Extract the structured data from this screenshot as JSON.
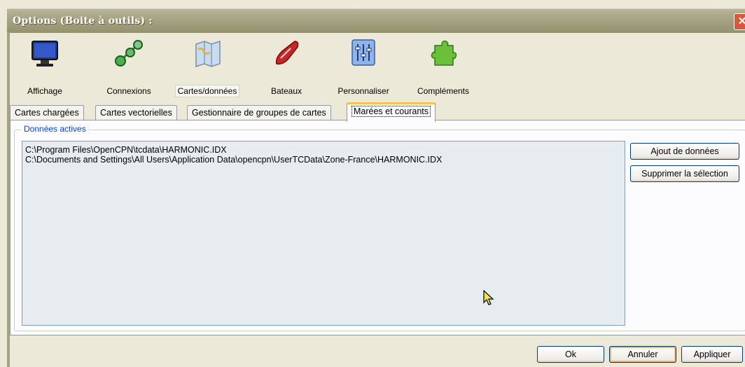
{
  "window": {
    "title": "Options (Boite à outils) :",
    "close_glyph": "✕"
  },
  "toolbar": {
    "items": [
      {
        "label": "Affichage",
        "icon": "monitor-icon"
      },
      {
        "label": "Connexions",
        "icon": "connections-icon"
      },
      {
        "label": "Cartes/données",
        "icon": "charts-icon",
        "selected": true
      },
      {
        "label": "Bateaux",
        "icon": "boat-icon"
      },
      {
        "label": "Personnaliser",
        "icon": "sliders-icon"
      },
      {
        "label": "Compléments",
        "icon": "puzzle-icon"
      }
    ]
  },
  "tabs": [
    {
      "label": "Cartes chargées"
    },
    {
      "label": "Cartes vectorielles"
    },
    {
      "label": "Gestionnaire de groupes de cartes"
    },
    {
      "label": "Marées et courants",
      "active": true
    }
  ],
  "group": {
    "title": "Données actives",
    "list": [
      "C:\\Program Files\\OpenCPN\\tcdata\\HARMONIC.IDX",
      "C:\\Documents and Settings\\All Users\\Application Data\\opencpn\\UserTCData\\Zone-France\\HARMONIC.IDX"
    ],
    "add_label": "Ajout de données",
    "remove_label": "Supprimer la sélection"
  },
  "footer": {
    "ok_label": "Ok",
    "cancel_label": "Annuler",
    "apply_label": "Appliquer"
  }
}
